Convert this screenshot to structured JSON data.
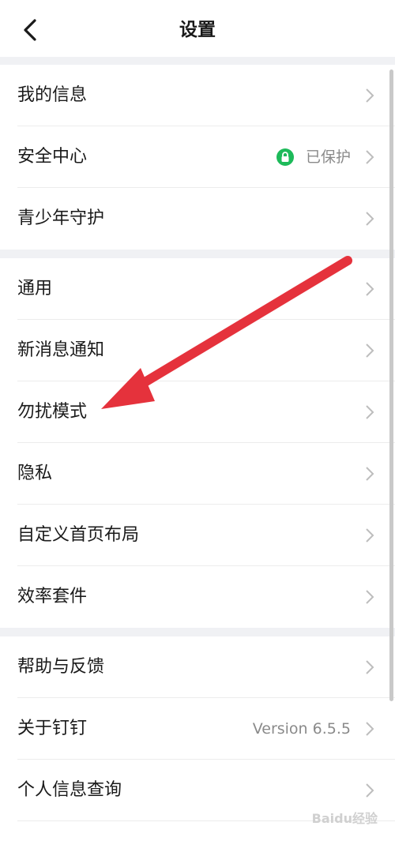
{
  "header": {
    "title": "设置"
  },
  "groups": [
    {
      "items": [
        {
          "label": "我的信息"
        },
        {
          "label": "安全中心",
          "status": "已保护"
        },
        {
          "label": "青少年守护"
        }
      ]
    },
    {
      "items": [
        {
          "label": "通用"
        },
        {
          "label": "新消息通知"
        },
        {
          "label": "勿扰模式"
        },
        {
          "label": "隐私"
        },
        {
          "label": "自定义首页布局"
        },
        {
          "label": "效率套件"
        }
      ]
    },
    {
      "items": [
        {
          "label": "帮助与反馈"
        },
        {
          "label": "关于钉钉",
          "value": "Version 6.5.5"
        },
        {
          "label": "个人信息查询"
        }
      ]
    }
  ],
  "colors": {
    "accent_green": "#1dba5a",
    "annotation_red": "#e5323c"
  },
  "watermark": "Baidu经验"
}
